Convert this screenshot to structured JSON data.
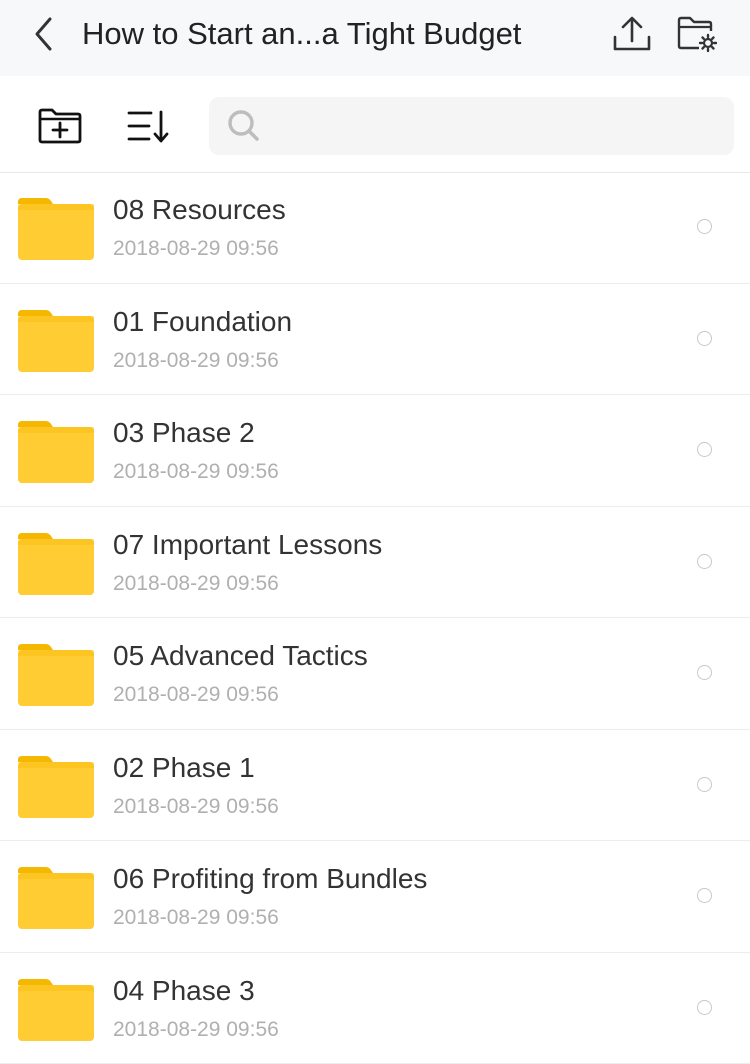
{
  "header": {
    "title": "How to Start an...a Tight Budget"
  },
  "search": {
    "placeholder": "",
    "value": ""
  },
  "colors": {
    "folder": "#ffcc33",
    "folder_tab": "#f5b800",
    "header_bg": "#f7f8fa"
  },
  "items": [
    {
      "name": "08 Resources",
      "date": "2018-08-29 09:56"
    },
    {
      "name": "01 Foundation",
      "date": "2018-08-29 09:56"
    },
    {
      "name": "03 Phase 2",
      "date": "2018-08-29 09:56"
    },
    {
      "name": "07 Important Lessons",
      "date": "2018-08-29 09:56"
    },
    {
      "name": "05 Advanced Tactics",
      "date": "2018-08-29 09:56"
    },
    {
      "name": "02 Phase 1",
      "date": "2018-08-29 09:56"
    },
    {
      "name": "06 Profiting from Bundles",
      "date": "2018-08-29 09:56"
    },
    {
      "name": "04 Phase 3",
      "date": "2018-08-29 09:56"
    }
  ]
}
